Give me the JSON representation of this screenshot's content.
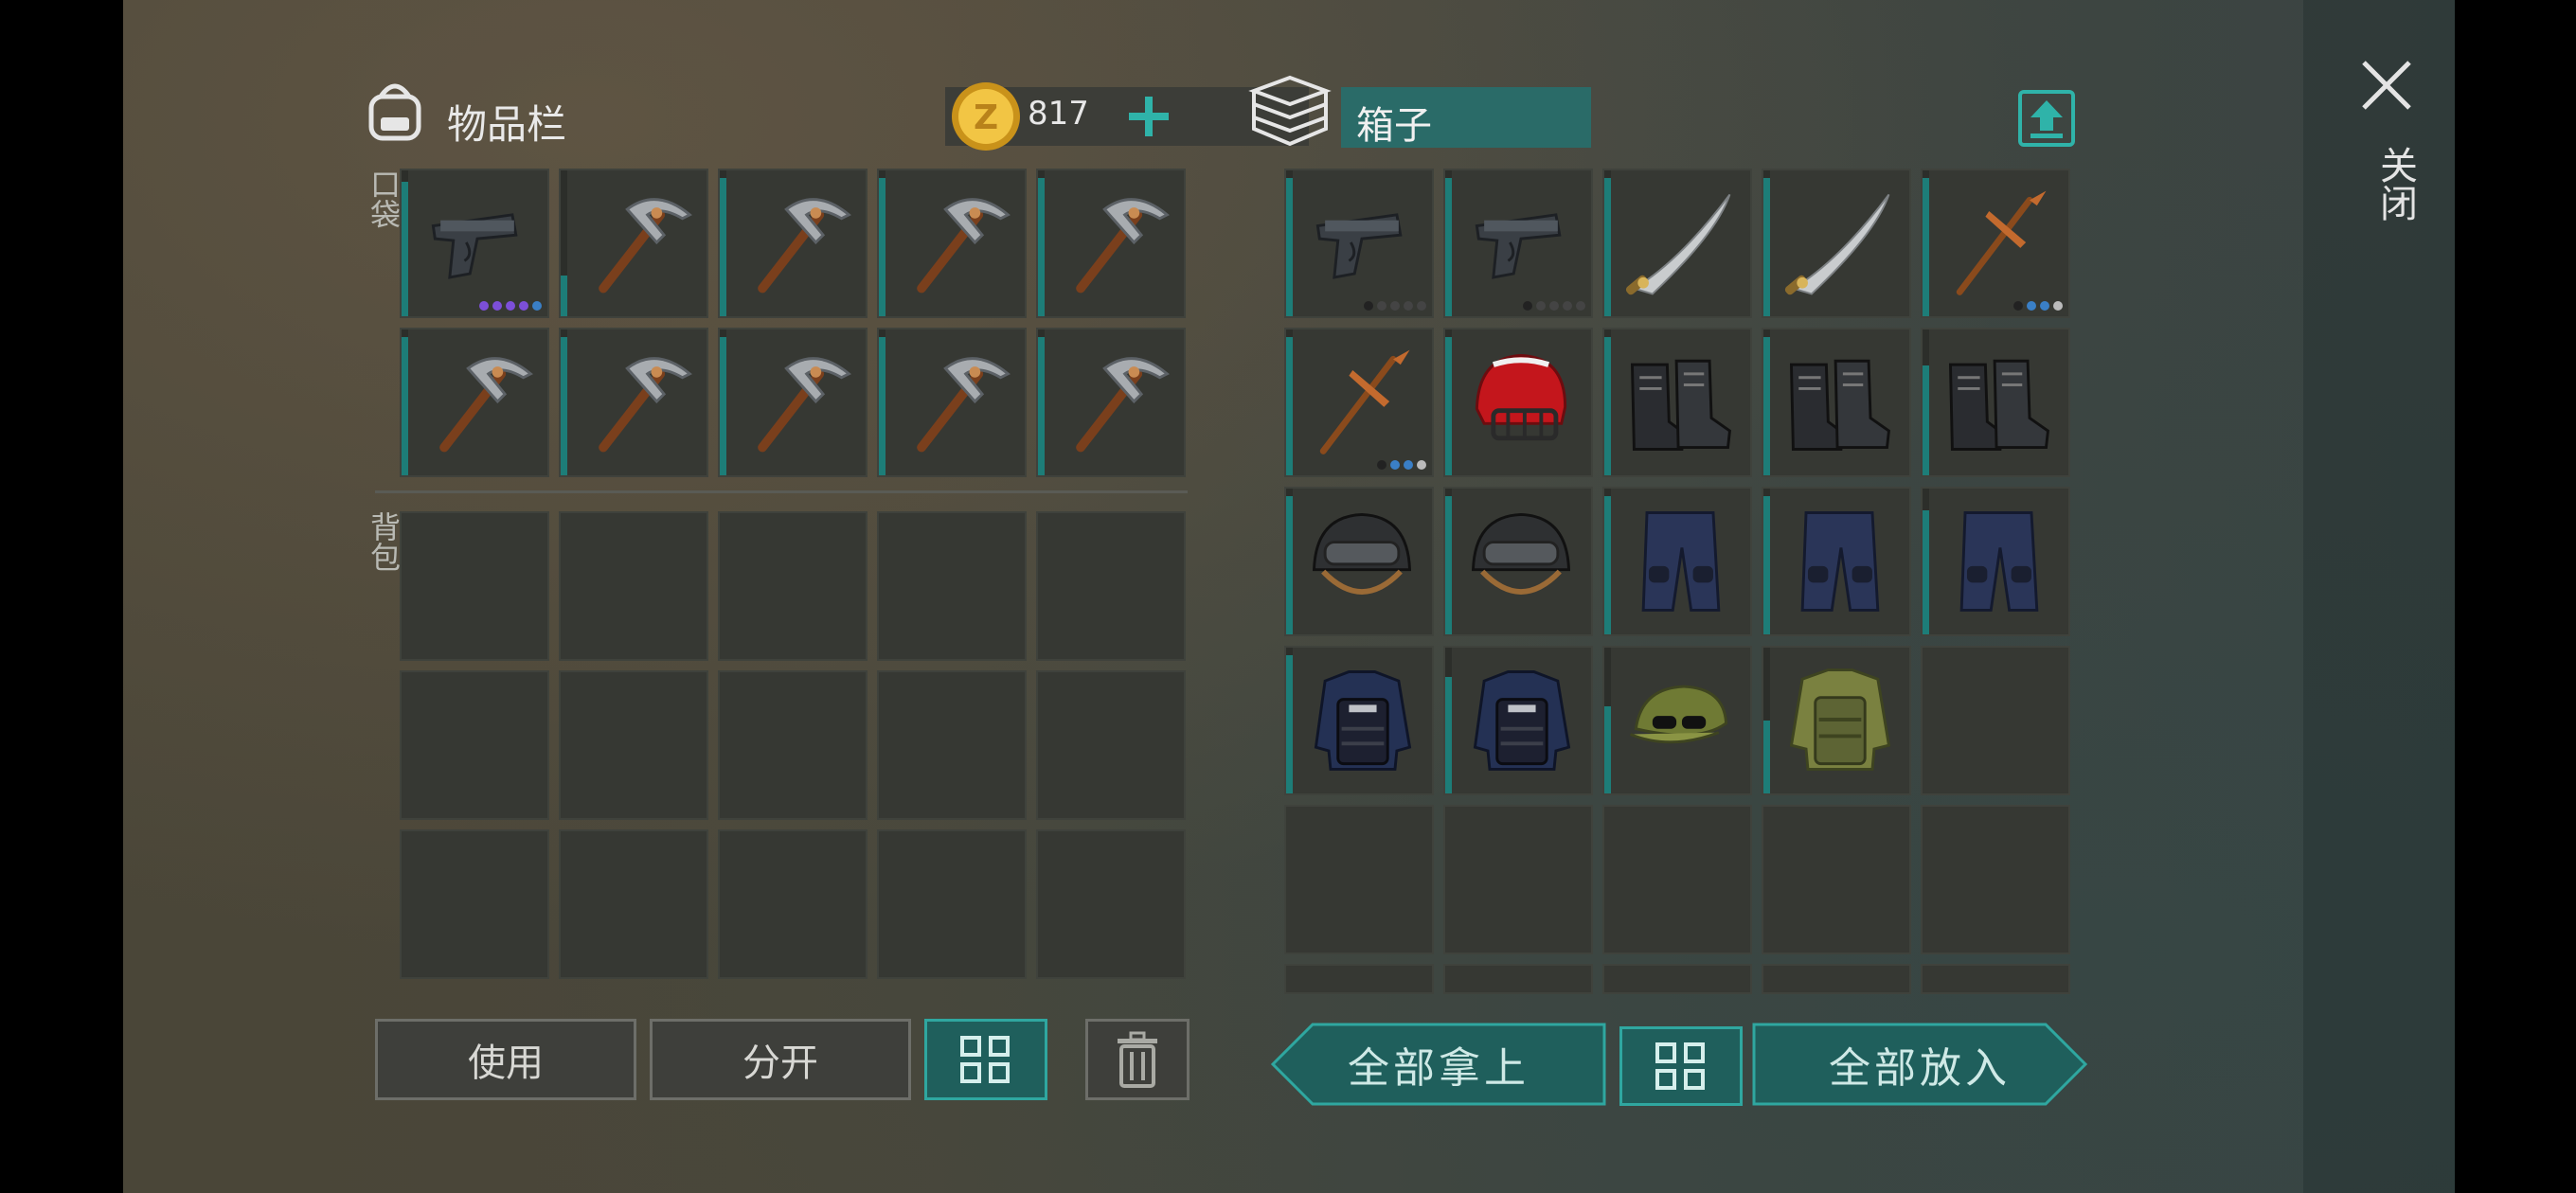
{
  "inventory": {
    "title": "物品栏",
    "coins": "817",
    "pocket_label": "口袋",
    "backpack_label": "背包",
    "pocket_slots": [
      {
        "item": "pistol",
        "dur": 0.92,
        "pips": [
          "#7c4fd8",
          "#7c4fd8",
          "#7c4fd8",
          "#7c4fd8",
          "#3a7fc6"
        ]
      },
      {
        "item": "pickaxe-stone",
        "dur": 0.28
      },
      {
        "item": "pickaxe-stone",
        "dur": 0.95
      },
      {
        "item": "pickaxe-stone",
        "dur": 0.95
      },
      {
        "item": "pickaxe-stone",
        "dur": 0.95
      },
      {
        "item": "pickaxe-stone",
        "dur": 0.95
      },
      {
        "item": "pickaxe-stone",
        "dur": 0.95
      },
      {
        "item": "pickaxe-stone",
        "dur": 0.95
      },
      {
        "item": "pickaxe-stone",
        "dur": 0.95
      },
      {
        "item": "pickaxe-stone",
        "dur": 0.95
      }
    ],
    "backpack_rows": 3
  },
  "box": {
    "title": "箱子",
    "slots": [
      {
        "item": "pistol",
        "dur": 0.95,
        "pips": [
          "#222",
          "#444",
          "#444",
          "#444",
          "#444"
        ]
      },
      {
        "item": "pistol",
        "dur": 0.95,
        "pips": [
          "#222",
          "#444",
          "#444",
          "#444",
          "#444"
        ]
      },
      {
        "item": "machete",
        "dur": 0.95
      },
      {
        "item": "machete",
        "dur": 0.95
      },
      {
        "item": "pickaxe-copper",
        "dur": 0.95,
        "pips": [
          "#222",
          "#3a7fc6",
          "#3a7fc6",
          "#bbb"
        ]
      },
      {
        "item": "pickaxe-copper",
        "dur": 0.95,
        "pips": [
          "#222",
          "#3a7fc6",
          "#3a7fc6",
          "#bbb"
        ]
      },
      {
        "item": "helmet-red",
        "dur": 0.95
      },
      {
        "item": "boots",
        "dur": 0.95
      },
      {
        "item": "boots",
        "dur": 0.95
      },
      {
        "item": "boots",
        "dur": 0.75
      },
      {
        "item": "helmet-black",
        "dur": 0.95
      },
      {
        "item": "helmet-black",
        "dur": 0.95
      },
      {
        "item": "pants",
        "dur": 0.95
      },
      {
        "item": "pants",
        "dur": 0.95
      },
      {
        "item": "pants",
        "dur": 0.85
      },
      {
        "item": "vest-police",
        "dur": 0.95
      },
      {
        "item": "vest-police",
        "dur": 0.8
      },
      {
        "item": "cap-camo",
        "dur": 0.6
      },
      {
        "item": "vest-camo",
        "dur": 0.5
      },
      {
        "item": "empty"
      }
    ],
    "empty_rows": 1
  },
  "buttons": {
    "use": "使用",
    "split": "分开",
    "take_all": "全部拿上",
    "put_all": "全部放入"
  },
  "close_label": "关闭",
  "colors": {
    "teal": "#2fa7a0",
    "teal_dark": "#1f5f5c",
    "durability": "#1d7d78"
  }
}
